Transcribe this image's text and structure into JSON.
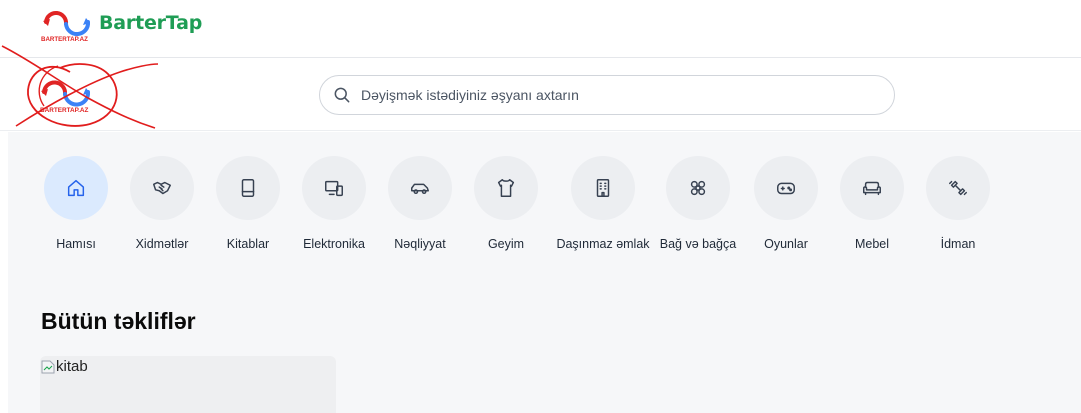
{
  "topbar": {
    "logo_text": "BARTERTAP.AZ",
    "brand_name": "BarterTap"
  },
  "header": {
    "logo_text": "BARTERTAP.AZ"
  },
  "search": {
    "placeholder": "Dəyişmək istədiyiniz əşyanı axtarın",
    "icon": "search-icon"
  },
  "categories": [
    {
      "label": "Hamısı",
      "icon": "home-icon",
      "active": true
    },
    {
      "label": "Xidmətlər",
      "icon": "handshake-icon"
    },
    {
      "label": "Kitablar",
      "icon": "book-icon"
    },
    {
      "label": "Elektronika",
      "icon": "devices-icon"
    },
    {
      "label": "Nəqliyyat",
      "icon": "car-icon"
    },
    {
      "label": "Geyim",
      "icon": "shirt-icon"
    },
    {
      "label": "Daşınmaz əmlak",
      "icon": "building-icon"
    },
    {
      "label": "Bağ və bağça",
      "icon": "flower-icon"
    },
    {
      "label": "Oyunlar",
      "icon": "gamepad-icon"
    },
    {
      "label": "Mebel",
      "icon": "sofa-icon"
    },
    {
      "label": "İdman",
      "icon": "dumbbell-icon"
    }
  ],
  "offers": {
    "title": "Bütün təkliflər",
    "items": [
      {
        "image_alt": "kitab"
      }
    ]
  },
  "colors": {
    "brand_green": "#1f9d55",
    "logo_red": "#e02424",
    "logo_blue": "#3b82f6",
    "active_bg": "#dbeafe",
    "active_icon": "#2563eb"
  }
}
